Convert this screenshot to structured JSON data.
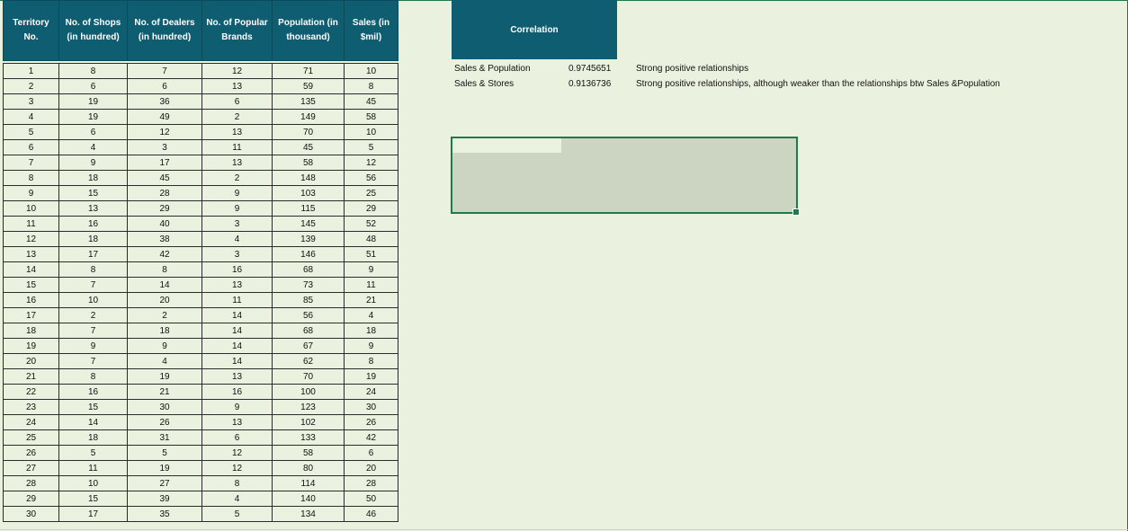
{
  "table": {
    "headers": [
      "Territory No.",
      "No. of Shops (in hundred)",
      "No. of Dealers (in hundred)",
      "No. of Popular Brands",
      "Population (in thousand)",
      "Sales (in $mil)"
    ],
    "rows": [
      [
        1,
        8,
        7,
        12,
        71,
        10
      ],
      [
        2,
        6,
        6,
        13,
        59,
        8
      ],
      [
        3,
        19,
        36,
        6,
        135,
        45
      ],
      [
        4,
        19,
        49,
        2,
        149,
        58
      ],
      [
        5,
        6,
        12,
        13,
        70,
        10
      ],
      [
        6,
        4,
        3,
        11,
        45,
        5
      ],
      [
        7,
        9,
        17,
        13,
        58,
        12
      ],
      [
        8,
        18,
        45,
        2,
        148,
        56
      ],
      [
        9,
        15,
        28,
        9,
        103,
        25
      ],
      [
        10,
        13,
        29,
        9,
        115,
        29
      ],
      [
        11,
        16,
        40,
        3,
        145,
        52
      ],
      [
        12,
        18,
        38,
        4,
        139,
        48
      ],
      [
        13,
        17,
        42,
        3,
        146,
        51
      ],
      [
        14,
        8,
        8,
        16,
        68,
        9
      ],
      [
        15,
        7,
        14,
        13,
        73,
        11
      ],
      [
        16,
        10,
        20,
        11,
        85,
        21
      ],
      [
        17,
        2,
        2,
        14,
        56,
        4
      ],
      [
        18,
        7,
        18,
        14,
        68,
        18
      ],
      [
        19,
        9,
        9,
        14,
        67,
        9
      ],
      [
        20,
        7,
        4,
        14,
        62,
        8
      ],
      [
        21,
        8,
        19,
        13,
        70,
        19
      ],
      [
        22,
        16,
        21,
        16,
        100,
        24
      ],
      [
        23,
        15,
        30,
        9,
        123,
        30
      ],
      [
        24,
        14,
        26,
        13,
        102,
        26
      ],
      [
        25,
        18,
        31,
        6,
        133,
        42
      ],
      [
        26,
        5,
        5,
        12,
        58,
        6
      ],
      [
        27,
        11,
        19,
        12,
        80,
        20
      ],
      [
        28,
        10,
        27,
        8,
        114,
        28
      ],
      [
        29,
        15,
        39,
        4,
        140,
        50
      ],
      [
        30,
        17,
        35,
        5,
        134,
        46
      ]
    ]
  },
  "correlation": {
    "header": "Correlation",
    "items": [
      {
        "label": "Sales & Population",
        "value": "0.9745651",
        "note": "Strong positive relationships"
      },
      {
        "label": "Sales & Stores",
        "value": "0.9136736",
        "note": "Strong positive relationships, although weaker than the relationships btw Sales &Population"
      }
    ]
  },
  "colors": {
    "header_bg": "#0f5d70",
    "sheet_bg": "#eaf1df",
    "selection_border": "#1f7a4a",
    "selection_fill": "#ccd4c2"
  }
}
